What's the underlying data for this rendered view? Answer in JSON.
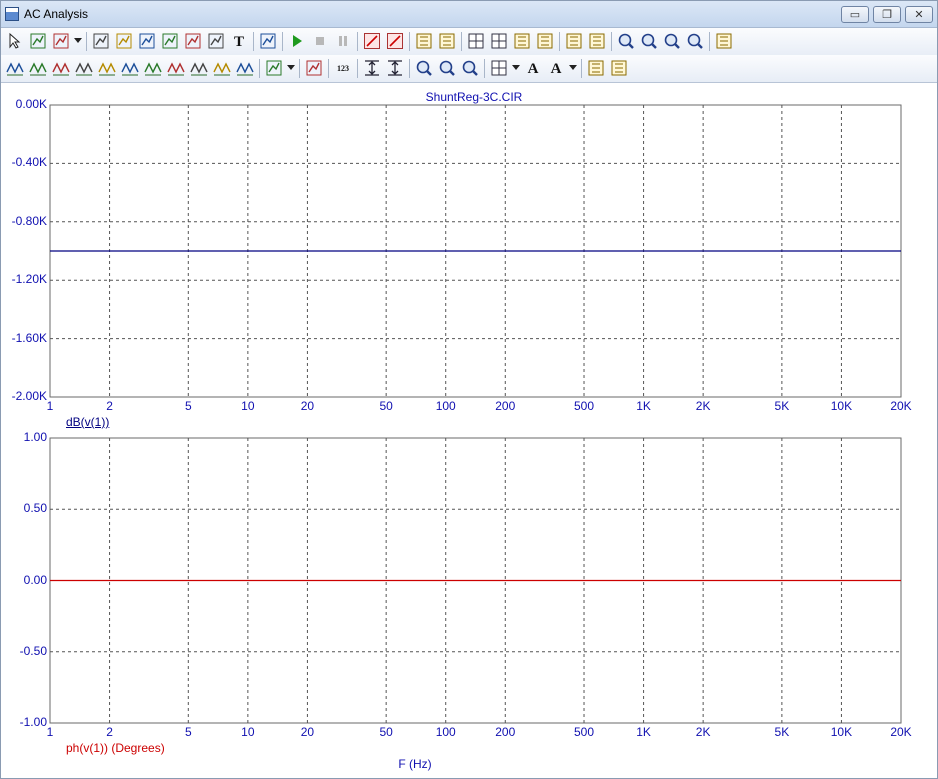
{
  "window": {
    "title": "AC Analysis",
    "minimize_glyph": "▭",
    "restore_glyph": "❐",
    "close_glyph": "✕"
  },
  "toolbar1": [
    {
      "name": "select-arrow-icon"
    },
    {
      "name": "pan-hand-icon"
    },
    {
      "name": "scale-dropdown-icon",
      "dropdown": true
    },
    {
      "name": "scale-icon"
    },
    {
      "name": "cursor-mode-icon"
    },
    {
      "name": "point-tag-icon"
    },
    {
      "name": "horizontal-tag-icon"
    },
    {
      "name": "vertical-tag-icon"
    },
    {
      "name": "formula-icon"
    },
    {
      "name": "text-icon",
      "text": "T"
    },
    {
      "name": "properties-icon"
    },
    {
      "name": "run-icon"
    },
    {
      "name": "stop-icon"
    },
    {
      "name": "pause-icon"
    },
    {
      "name": "data-points-icon"
    },
    {
      "name": "tokens-icon"
    },
    {
      "name": "ruler-icon"
    },
    {
      "name": "plus-mode-icon"
    },
    {
      "name": "grid-icon"
    },
    {
      "name": "minor-grid-icon"
    },
    {
      "name": "axis-icon"
    },
    {
      "name": "horizontal-axis-icon"
    },
    {
      "name": "separate-plots-icon"
    },
    {
      "name": "same-y-scales-icon"
    },
    {
      "name": "zoom-in-icon"
    },
    {
      "name": "zoom-out-icon"
    },
    {
      "name": "zoom-fit-icon"
    },
    {
      "name": "zoom-window-icon"
    },
    {
      "name": "plot-properties-icon"
    }
  ],
  "toolbar2": [
    {
      "name": "next-simulation-icon"
    },
    {
      "name": "prev-simulation-icon"
    },
    {
      "name": "peak-icon"
    },
    {
      "name": "valley-icon"
    },
    {
      "name": "high-icon"
    },
    {
      "name": "low-icon"
    },
    {
      "name": "inflection-icon"
    },
    {
      "name": "global-high-icon"
    },
    {
      "name": "global-low-icon"
    },
    {
      "name": "top-icon"
    },
    {
      "name": "bottom-icon"
    },
    {
      "name": "clipboard-icon",
      "dropdown": true
    },
    {
      "name": "numeric-output-icon"
    },
    {
      "name": "digits-icon",
      "text": "123"
    },
    {
      "name": "fit-width-icon"
    },
    {
      "name": "fit-height-icon"
    },
    {
      "name": "magnify-plus-icon"
    },
    {
      "name": "magnify-minus-icon"
    },
    {
      "name": "magnify-fit-icon"
    },
    {
      "name": "grid-layout-icon",
      "dropdown": true
    },
    {
      "name": "font-icon",
      "text": "A"
    },
    {
      "name": "text-style-icon",
      "text": "A",
      "dropdown": true
    },
    {
      "name": "copy-plot-icon"
    },
    {
      "name": "paste-plot-icon"
    }
  ],
  "chart_data": [
    {
      "type": "line",
      "title": "ShuntReg-3C.CIR",
      "x_scale": "log",
      "xlim": [
        1,
        20000
      ],
      "x_ticks": [
        1,
        2,
        5,
        10,
        20,
        50,
        100,
        200,
        500,
        1000,
        2000,
        5000,
        10000,
        20000
      ],
      "x_tick_labels": [
        "1",
        "2",
        "5",
        "10",
        "20",
        "50",
        "100",
        "200",
        "500",
        "1K",
        "2K",
        "5K",
        "10K",
        "20K"
      ],
      "ylim": [
        -2000,
        0
      ],
      "y_ticks": [
        0,
        -400,
        -800,
        -1200,
        -1600,
        -2000
      ],
      "y_tick_labels": [
        "0.00K",
        "-0.40K",
        "-0.80K",
        "-1.20K",
        "-1.60K",
        "-2.00K"
      ],
      "grid": true,
      "series": [
        {
          "name": "dB(v(1))",
          "color": "#000080",
          "x": [
            1,
            20000
          ],
          "y": [
            -1000,
            -1000
          ]
        }
      ]
    },
    {
      "type": "line",
      "title": "",
      "x_scale": "log",
      "xlim": [
        1,
        20000
      ],
      "x_ticks": [
        1,
        2,
        5,
        10,
        20,
        50,
        100,
        200,
        500,
        1000,
        2000,
        5000,
        10000,
        20000
      ],
      "x_tick_labels": [
        "1",
        "2",
        "5",
        "10",
        "20",
        "50",
        "100",
        "200",
        "500",
        "1K",
        "2K",
        "5K",
        "10K",
        "20K"
      ],
      "xlabel": "F (Hz)",
      "ylim": [
        -1,
        1
      ],
      "y_ticks": [
        1,
        0.5,
        0,
        -0.5,
        -1
      ],
      "y_tick_labels": [
        "1.00",
        "0.50",
        "0.00",
        "-0.50",
        "-1.00"
      ],
      "grid": true,
      "series": [
        {
          "name": "ph(v(1)) (Degrees)",
          "color": "#cc0000",
          "x": [
            1,
            20000
          ],
          "y": [
            0,
            0
          ]
        }
      ]
    }
  ]
}
